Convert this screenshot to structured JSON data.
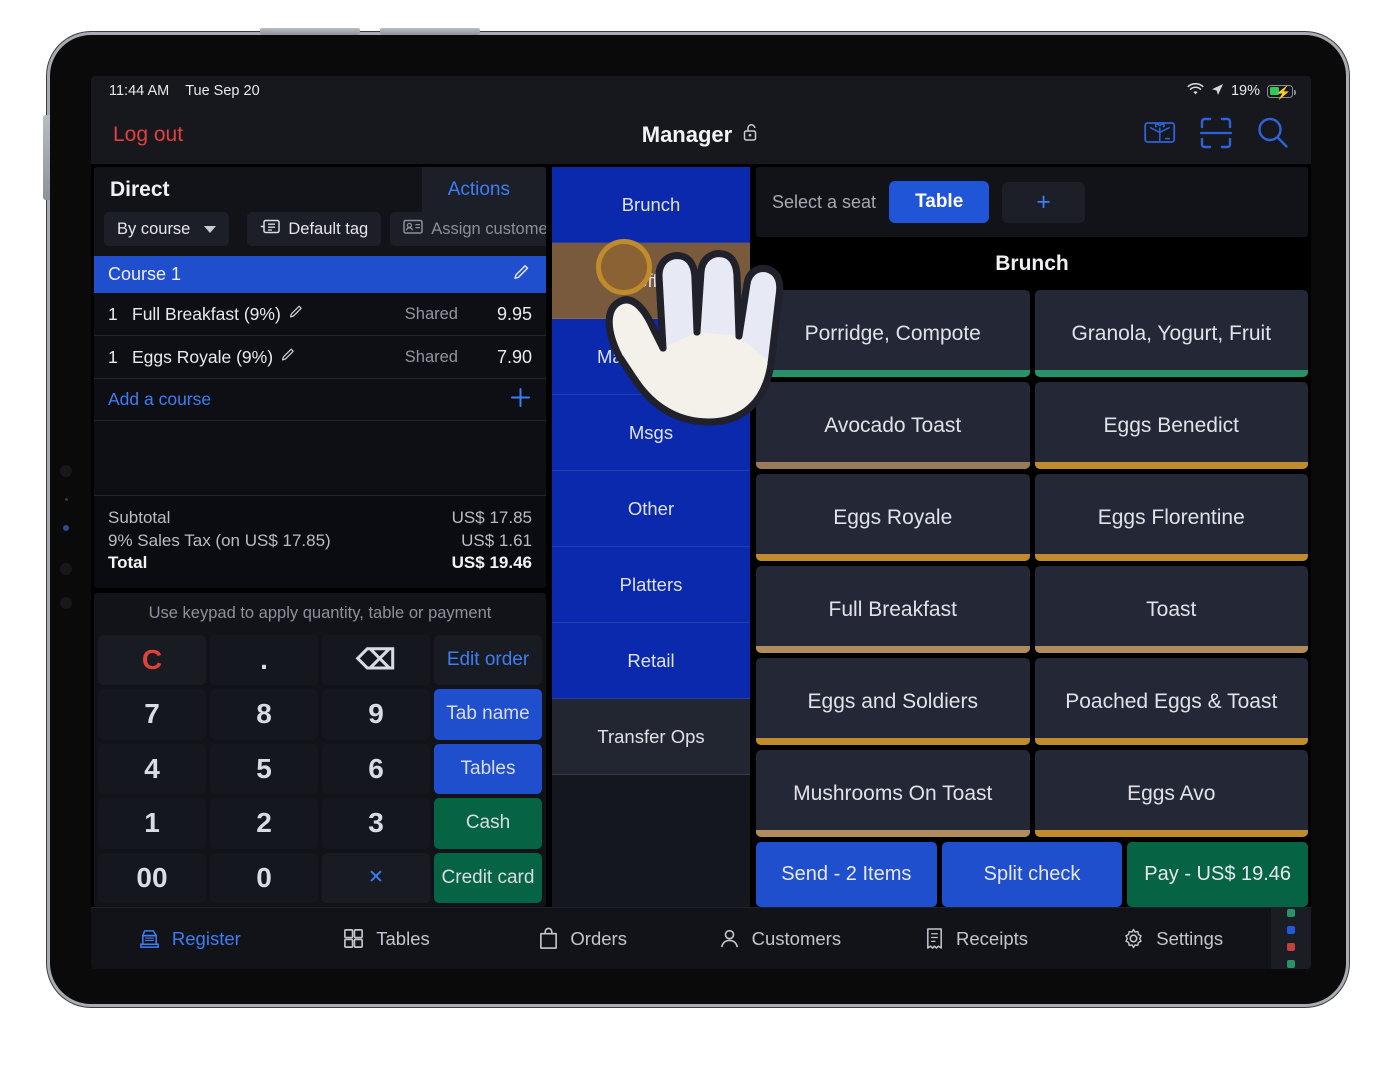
{
  "status_bar": {
    "time": "11:44 AM",
    "date": "Tue Sep 20",
    "battery_percent": "19%",
    "wifi_icon": "wifi-icon",
    "location_icon": "location-arrow-icon",
    "battery_icon": "battery-charging-icon"
  },
  "header": {
    "logout_label": "Log out",
    "title": "Manager",
    "lock_icon": "unlocked-padlock-icon",
    "icons": [
      "gift-card-icon",
      "barcode-scan-icon",
      "search-icon"
    ]
  },
  "order_panel": {
    "title": "Direct",
    "actions_label": "Actions",
    "sort_label": "By course",
    "tag_label": "Default tag",
    "assign_label": "Assign customer",
    "course_label": "Course 1",
    "items": [
      {
        "qty": "1",
        "name": "Full Breakfast (9%)",
        "share": "Shared",
        "price": "9.95"
      },
      {
        "qty": "1",
        "name": "Eggs Royale (9%)",
        "share": "Shared",
        "price": "7.90"
      }
    ],
    "add_course_label": "Add a course",
    "totals": [
      {
        "label": "Subtotal",
        "value": "US$ 17.85"
      },
      {
        "label": "9% Sales Tax (on US$ 17.85)",
        "value": "US$ 1.61"
      },
      {
        "label": "Total",
        "value": "US$ 19.46"
      }
    ]
  },
  "keypad": {
    "hint": "Use keypad to apply quantity, table or payment",
    "keys": [
      {
        "label": "C",
        "style": "red"
      },
      {
        "label": ".",
        "style": "flat"
      },
      {
        "label": "⌫",
        "style": "flat"
      },
      {
        "label": "Edit order",
        "style": "link"
      },
      {
        "label": "7",
        "style": "flat"
      },
      {
        "label": "8",
        "style": "flat"
      },
      {
        "label": "9",
        "style": "flat"
      },
      {
        "label": "Tab name",
        "style": "blue"
      },
      {
        "label": "4",
        "style": "flat"
      },
      {
        "label": "5",
        "style": "flat"
      },
      {
        "label": "6",
        "style": "flat"
      },
      {
        "label": "Tables",
        "style": "blue"
      },
      {
        "label": "1",
        "style": "flat"
      },
      {
        "label": "2",
        "style": "flat"
      },
      {
        "label": "3",
        "style": "flat"
      },
      {
        "label": "Cash",
        "style": "green"
      },
      {
        "label": "00",
        "style": "flat"
      },
      {
        "label": "0",
        "style": "flat"
      },
      {
        "label": "✕",
        "style": "link"
      },
      {
        "label": "Credit card",
        "style": "green"
      }
    ]
  },
  "categories": [
    {
      "label": "Brunch",
      "color": "#0a29ad",
      "selected": true
    },
    {
      "label": "Coffee",
      "color": "#7a5a3c",
      "selected": false
    },
    {
      "label": "Management",
      "color": "#0a29ad",
      "selected": false
    },
    {
      "label": "Msgs",
      "color": "#0a29ad",
      "selected": false
    },
    {
      "label": "Other",
      "color": "#0a29ad",
      "selected": false
    },
    {
      "label": "Platters",
      "color": "#0a29ad",
      "selected": false
    },
    {
      "label": "Retail",
      "color": "#0a29ad",
      "selected": false
    },
    {
      "label": "Transfer Ops",
      "color": "#222630",
      "selected": false
    }
  ],
  "seat_bar": {
    "label": "Select a seat",
    "selected": "Table",
    "add_label": "+"
  },
  "products": {
    "title": "Brunch",
    "tiles": [
      {
        "label": "Porridge, Compote",
        "accent": "#2a9268"
      },
      {
        "label": "Granola, Yogurt, Fruit",
        "accent": "#2a9268"
      },
      {
        "label": "Avocado Toast",
        "accent": "#9b7a5a"
      },
      {
        "label": "Eggs Benedict",
        "accent": "#c08b2c"
      },
      {
        "label": "Eggs Royale",
        "accent": "#c08b2c"
      },
      {
        "label": "Eggs Florentine",
        "accent": "#c08b2c"
      },
      {
        "label": "Full Breakfast",
        "accent": "#b08b5e"
      },
      {
        "label": "Toast",
        "accent": "#b08b5e"
      },
      {
        "label": "Eggs and Soldiers",
        "accent": "#c08b2c"
      },
      {
        "label": "Poached Eggs & Toast",
        "accent": "#c08b2c"
      },
      {
        "label": "Mushrooms On Toast",
        "accent": "#b08b5e"
      },
      {
        "label": "Eggs Avo",
        "accent": "#c08b2c"
      }
    ]
  },
  "pay_bar": [
    {
      "label": "Send - 2 Items",
      "style": "blue"
    },
    {
      "label": "Split check",
      "style": "blue"
    },
    {
      "label": "Pay - US$ 19.46",
      "style": "green"
    }
  ],
  "tab_bar": {
    "tabs": [
      {
        "label": "Register",
        "icon": "cash-register-icon",
        "active": true
      },
      {
        "label": "Tables",
        "icon": "grid-icon",
        "active": false
      },
      {
        "label": "Orders",
        "icon": "shopping-bag-icon",
        "active": false
      },
      {
        "label": "Customers",
        "icon": "person-icon",
        "active": false
      },
      {
        "label": "Receipts",
        "icon": "receipt-icon",
        "active": false
      },
      {
        "label": "Settings",
        "icon": "gear-icon",
        "active": false
      }
    ],
    "status_dots": [
      "#2a9268",
      "#2358d8",
      "#c2413e",
      "#2a9268"
    ]
  },
  "cursor": {
    "icon": "hand-pointer-cursor"
  }
}
